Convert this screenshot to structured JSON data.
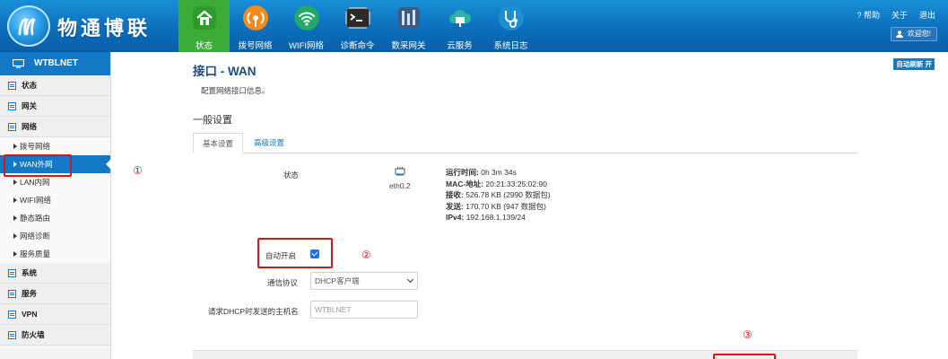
{
  "header": {
    "brand": "物通博联",
    "nav": [
      {
        "label": "状态",
        "icon": "home-icon",
        "active": true
      },
      {
        "label": "拨号网络",
        "icon": "dialup-signal-icon",
        "active": false
      },
      {
        "label": "WIFI网络",
        "icon": "wifi-icon",
        "active": false
      },
      {
        "label": "诊断命令",
        "icon": "terminal-icon",
        "active": false
      },
      {
        "label": "数采网关",
        "icon": "data-gateway-icon",
        "active": false
      },
      {
        "label": "云服务",
        "icon": "cloud-service-icon",
        "active": false
      },
      {
        "label": "系统日志",
        "icon": "stethoscope-icon",
        "active": false
      }
    ],
    "links": {
      "help": "? 帮助",
      "about": "关于",
      "logout": "退出"
    },
    "welcome": "欢迎您!"
  },
  "sidebar": {
    "title": "WTBLNET",
    "items": [
      {
        "type": "cat",
        "label": "状态"
      },
      {
        "type": "cat",
        "label": "网关"
      },
      {
        "type": "cat",
        "label": "网络"
      },
      {
        "type": "sub",
        "label": "拨号网络"
      },
      {
        "type": "sub",
        "label": "WAN外网",
        "active": true
      },
      {
        "type": "sub",
        "label": "LAN内网"
      },
      {
        "type": "sub",
        "label": "WIFI网络"
      },
      {
        "type": "sub",
        "label": "静态路由"
      },
      {
        "type": "sub",
        "label": "网络诊断"
      },
      {
        "type": "sub",
        "label": "服务质量"
      },
      {
        "type": "cat",
        "label": "系统"
      },
      {
        "type": "cat",
        "label": "服务"
      },
      {
        "type": "cat",
        "label": "VPN"
      },
      {
        "type": "cat",
        "label": "防火墙"
      }
    ]
  },
  "main": {
    "auto_refresh": "自动刷新 开",
    "title": "接口 - WAN",
    "description": "配置网络接口信息。",
    "section": "一般设置",
    "tabs": {
      "basic": "基本设置",
      "advanced": "高级设置"
    },
    "status": {
      "label": "状态",
      "interface": "eth0.2",
      "uptime_key": "运行时间:",
      "uptime": "0h 3m 34s",
      "mac_key": "MAC-地址:",
      "mac": "20:21:33:25:02:90",
      "rx_key": "接收:",
      "rx": "526.78 KB (2990 数据包)",
      "tx_key": "发送:",
      "tx": "170.70 KB (947 数据包)",
      "ipv4_key": "IPv4:",
      "ipv4": "192.168.1.139/24"
    },
    "auto_start": {
      "label": "自动开启",
      "checked": true
    },
    "protocol": {
      "label": "通信协议",
      "value": "DHCP客户端"
    },
    "hostname": {
      "label": "请求DHCP时发送的主机名",
      "placeholder": "WTBLNET"
    }
  },
  "annotations": [
    "①",
    "②",
    "③"
  ],
  "colors": {
    "header": "#0b6fbc",
    "active_nav": "#3dad3a",
    "accent": "#1479c4",
    "annotation": "#d9141a"
  }
}
